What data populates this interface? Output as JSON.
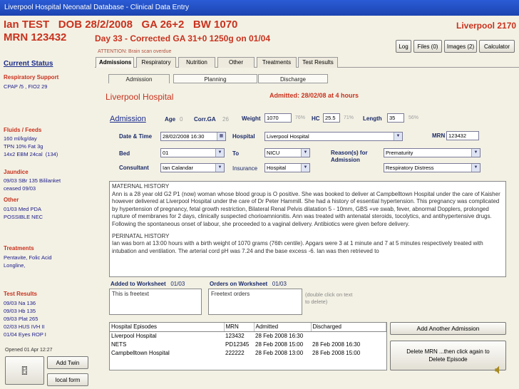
{
  "window": {
    "title": "Liverpool Hospital Neonatal Database - Clinical Data Entry"
  },
  "patient": {
    "name": "Ian TEST",
    "dob": "DOB 28/2/2008",
    "ga": "GA 26+2",
    "bw": "BW 1070",
    "mrn": "MRN 123432",
    "day_line": "Day 33 - Corrected GA 31+0   1250g on 01/04",
    "attention": "ATTENTION: Brain scan overdue",
    "hospital_code": "Liverpool  2170"
  },
  "toolbar": {
    "log": "Log",
    "files": "Files (0)",
    "images": "Images (2)",
    "calculator": "Calculator"
  },
  "sidebar": {
    "current_status": "Current Status",
    "sections": [
      {
        "title": "Respiratory Support",
        "text": "CPAP /5 , FIO2 29"
      },
      {
        "title": "Fluids / Feeds",
        "text": "160 ml/kg/day\nTPN 10% Fat 3g\n14x2 EBM 24cal  (134)"
      },
      {
        "title": "Jaundice",
        "text": "09/03 SBr 135 Bililanket\nceased 09/03"
      },
      {
        "title": "Other",
        "text": "01/03 Med PDA\nPOSSIBLE NEC"
      },
      {
        "title": "Treatments",
        "text": "Pentavite, Folic Acid\nLongline,"
      },
      {
        "title": "Test Results",
        "text": "09/03 Na 136\n09/03 Hb 135\n09/03 Plat 265\n02/03 HUS IVH II\n01/04 Eyes ROP I"
      }
    ],
    "opened": "Opened 01 Apr 12:27",
    "add_twin": "Add Twin",
    "local_form": "local form"
  },
  "tabs": [
    "Admissions",
    "Respiratory",
    "Nutrition",
    "Other",
    "Treatments",
    "Test Results"
  ],
  "subtabs": [
    "Admission",
    "Planning",
    "Discharge"
  ],
  "admission": {
    "hospital_title": "Liverpool Hospital",
    "admitted": "Admitted: 28/02/08 at 4 hours",
    "heading": "Admission",
    "age_label": "Age",
    "age_value": "0",
    "corr_ga_label": "Corr.GA",
    "corr_ga_value": "26",
    "weight_label": "Weight",
    "weight_value": "1070",
    "weight_pct": "76%",
    "hc_label": "HC",
    "hc_value": "25.5",
    "hc_pct": "71%",
    "length_label": "Length",
    "length_value": "35",
    "length_pct": "56%",
    "datetime_label": "Date & Time",
    "datetime_value": "28/02/2008 16:30",
    "hospital_label": "Hospital",
    "hospital_value": "Liverpool Hospital",
    "mrn_label": "MRN",
    "mrn_value": "123432",
    "bed_label": "Bed",
    "bed_value": "01",
    "to_label": "To",
    "to_value": "NICU",
    "reason_label": "Reason(s) for Admission",
    "reason1": "Prematurity",
    "reason2": "Respiratory Distress",
    "consultant_label": "Consultant",
    "consultant_value": "Ian Calandar",
    "insurance_label": "Insurance",
    "insurance_value": "Hospital"
  },
  "history": {
    "maternal_title": "MATERNAL HISTORY",
    "maternal_text": "Ann is a 28 year old G2 P1 (now) woman whose blood group is O positive. She  was booked to deliver at Campbelltown Hospital under the care of Kaisher however delivered at Liverpool Hospital under the care of Dr Peter Hammill. She had a history of essential hypertension. This pregnancy was complicated by hypertension of pregnancy, fetal growth restriction, Bilateral Renal Pelvis dilatation 5 - 10mm, GBS +ve swab, fever, abnormal Dopplers, prolonged rupture of membranes for 2 days, clinically suspected chorioamnionitis. Ann was treated with antenatal steroids, tocolytics, and antihypertensive drugs. Following the spontaneous onset of labour, she proceeded to a vaginal delivery.  Antibiotics were given before delivery.",
    "perinatal_title": "PERINATAL HISTORY",
    "perinatal_text": "Ian was born at 13:00 hours with a birth weight of 1070 grams (76th centile). Apgars were 3 at 1 minute and 7 at 5 minutes respectively treated with intubation and ventilation. The arterial cord pH was 7.24 and the base excess -6. Ian was then retrieved to"
  },
  "worksheet": {
    "added_label": "Added to Worksheet",
    "added_date": "01/03",
    "added_text": "This is freetext",
    "orders_label": "Orders on Worksheet",
    "orders_date": "01/03",
    "orders_text": "Freetext orders",
    "hint": "(double click on text to delete)"
  },
  "episodes": {
    "headers": [
      "Hospital Episodes",
      "MRN",
      "Admitted",
      "Discharged"
    ],
    "rows": [
      [
        "Liverpool Hospital",
        "123432",
        "28 Feb 2008 16:30",
        ""
      ],
      [
        "NETS",
        "PD12345",
        "28 Feb 2008 15:00",
        "28 Feb 2008 16:30"
      ],
      [
        "Campbelltown Hospital",
        "222222",
        "28 Feb 2008 13:00",
        "28 Feb 2008 15:00"
      ]
    ],
    "add_another": "Add Another Admission",
    "delete_hint": "Delete  MRN  ...then click again to Delete  Episode"
  },
  "icons": {
    "exit": "exit-door-icon",
    "speaker": "speaker-icon"
  }
}
